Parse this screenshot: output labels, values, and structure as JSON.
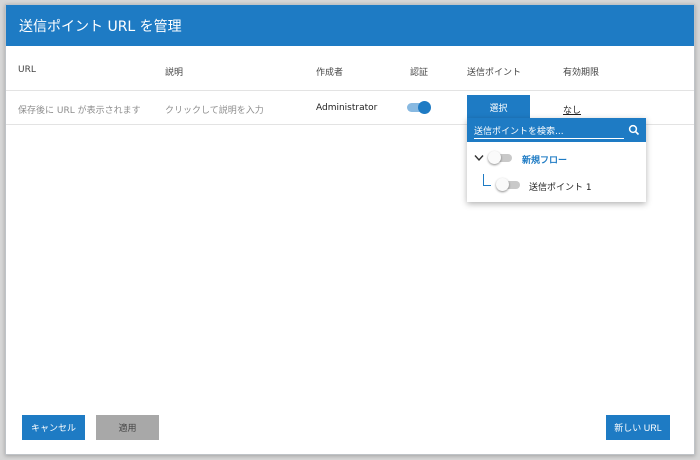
{
  "dialog": {
    "title": "送信ポイント URL を管理"
  },
  "table": {
    "headers": [
      "URL",
      "説明",
      "作成者",
      "認証",
      "送信ポイント",
      "有効期限"
    ],
    "row": {
      "url_placeholder": "保存後に URL が表示されます",
      "description_placeholder": "クリックして説明を入力",
      "author": "Administrator",
      "auth_enabled": true,
      "select_label": "選択",
      "expiry": "なし"
    }
  },
  "dropdown": {
    "search_placeholder": "送信ポイントを検索...",
    "flow": {
      "label": "新規フロー",
      "enabled": false
    },
    "points": [
      {
        "label": "送信ポイント 1",
        "enabled": false
      }
    ]
  },
  "footer": {
    "cancel_label": "キャンセル",
    "apply_label": "適用",
    "new_url_label": "新しい URL"
  },
  "colors": {
    "accent": "#1e7bc4",
    "disabled": "#a8a8a8"
  }
}
